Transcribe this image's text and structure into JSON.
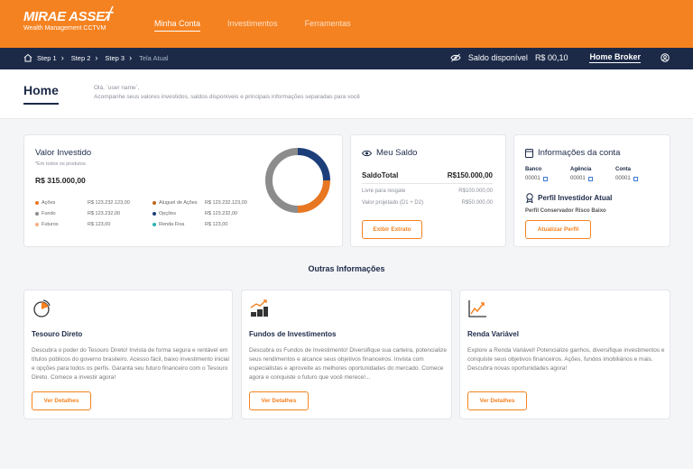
{
  "brand": {
    "name": "MIRAE ASSET",
    "subtitle": "Wealth Management CCTVM"
  },
  "nav": [
    "Minha Conta",
    "Investimentos",
    "Ferramentas"
  ],
  "breadcrumb": [
    "Step 1",
    "Step 2",
    "Step 3",
    "Tela Atual"
  ],
  "topbar": {
    "saldo_label": "Saldo disponível",
    "saldo_value": "R$ 00,10",
    "home_broker": "Home Broker"
  },
  "page": {
    "title": "Home",
    "greeting": "Olá, `user name`,",
    "subtitle": "Acompanhe seus valores investidos, saldos disponíveis e principais informações separadas para você"
  },
  "valor_investido": {
    "title": "Valor Investido",
    "note": "*Em todos os produtos.",
    "total": "R$ 315.000,00",
    "items": [
      {
        "label": "Ações",
        "value": "R$ 123.232.123,00",
        "color": "#e87722"
      },
      {
        "label": "Fundo",
        "value": "R$ 123.232,00",
        "color": "#8c8c8c"
      },
      {
        "label": "Futuros",
        "value": "R$ 123,00",
        "color": "#f4b183"
      },
      {
        "label": "Aluguel de Ações",
        "value": "R$ 123.232.123,00",
        "color": "#c0651a"
      },
      {
        "label": "Opções",
        "value": "R$ 123.232,00",
        "color": "#1c3f7a"
      },
      {
        "label": "Renda Fixa",
        "value": "R$ 123,00",
        "color": "#2ab0b0"
      }
    ],
    "donut": [
      {
        "label": "Ações",
        "share": 0.25,
        "color": "#1c3f7a"
      },
      {
        "label": "Fundo",
        "share": 0.25,
        "color": "#e87722"
      },
      {
        "label": "Futuros",
        "share": 0.5,
        "color": "#8c8c8c"
      }
    ]
  },
  "meu_saldo": {
    "title": "Meu Saldo",
    "total_label": "SaldoTotal",
    "total_value": "R$150.000,00",
    "rows": [
      {
        "label": "Livre para resgate",
        "value": "R$100.000,00"
      },
      {
        "label": "Valor projetado (D1 + D2)",
        "value": "R$50.000,00"
      }
    ],
    "button": "Exibir Extrato"
  },
  "conta": {
    "title": "Informações da conta",
    "fields": [
      {
        "label": "Banco",
        "value": "00001"
      },
      {
        "label": "Agência",
        "value": "00001"
      },
      {
        "label": "Conta",
        "value": "00001"
      }
    ],
    "perfil_title": "Perfil Investidor Atual",
    "perfil_value": "Perfil Conservador Risco Baixo",
    "button": "Atualizar Perfil"
  },
  "outras": {
    "title": "Outras Informações",
    "cards": [
      {
        "title": "Tesouro Direto",
        "desc": "Descubra o poder do Tesouro Direto! Invista de forma segura e rentável em títulos públicos do governo brasileiro. Acesso fácil, baixo investimento inicial e opções para todos os perfis. Garanta seu futuro financeiro com o Tesouro Direto. Comece a investir agora!",
        "button": "Ver Detalhes",
        "icon": "pie-chart-icon"
      },
      {
        "title": "Fundos de Investimentos",
        "desc": "Descubra os Fundos de Investimento! Diversifique sua carteira, potencialize seus rendimentos e alcance seus objetivos financeiros. Invista com especialistas e aproveite as melhores oportunidades do mercado. Comece agora e conquiste o futuro que você merece!...",
        "button": "Ver Detalhes",
        "icon": "coins-growth-icon"
      },
      {
        "title": "Renda Variável",
        "desc": "Explore a Renda Variável! Potencialize ganhos, diversifique investimentos e conquiste seus objetivos financeiros. Ações, fundos imobiliários e mais. Descubra novas oportunidades agora!",
        "button": "Ver Detalhes",
        "icon": "line-chart-icon"
      }
    ]
  },
  "colors": {
    "orange": "#f58220",
    "navy": "#1c2a48"
  }
}
